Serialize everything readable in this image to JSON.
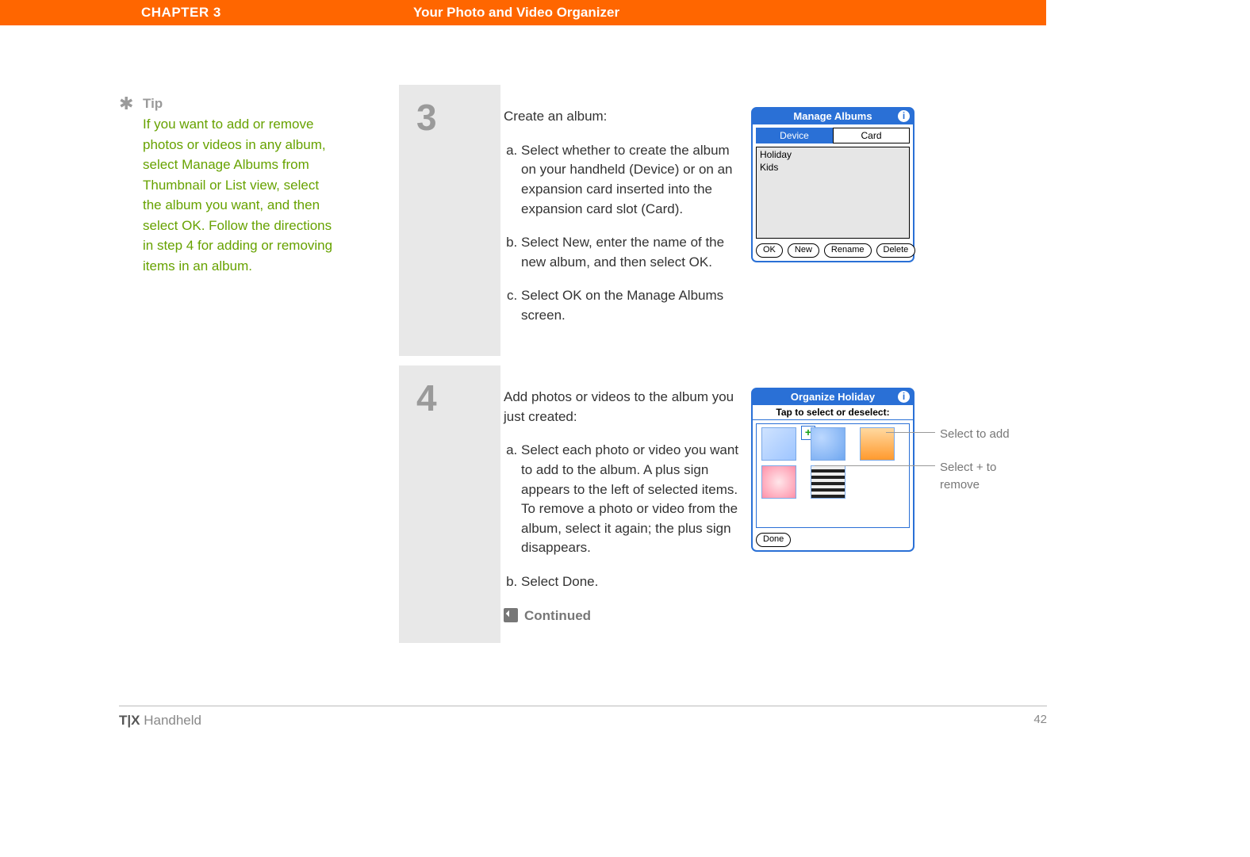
{
  "header": {
    "chapter": "CHAPTER 3",
    "title": "Your Photo and Video Organizer"
  },
  "tip": {
    "star": "✱",
    "label": "Tip",
    "body": "If you want to add or remove photos or videos in any album, select Manage Albums from Thumbnail or List view, select the album you want, and then select OK. Follow the directions in step 4 for adding or removing items in an album."
  },
  "step3": {
    "num": "3",
    "lead": "Create an album:",
    "a": "Select whether to create the album on your handheld (Device) or on an expansion card inserted into the expansion card slot (Card).",
    "b": "Select New, enter the name of the new album, and then select OK.",
    "c": "Select OK on the Manage Albums screen.",
    "palm": {
      "title": "Manage Albums",
      "tab_device": "Device",
      "tab_card": "Card",
      "album1": "Holiday",
      "album2": "Kids",
      "btn_ok": "OK",
      "btn_new": "New",
      "btn_rename": "Rename",
      "btn_delete": "Delete"
    }
  },
  "step4": {
    "num": "4",
    "lead": "Add photos or videos to the album you just created:",
    "a": "Select each photo or video you want to add to the album. A plus sign appears to the left of selected items. To remove a photo or video from the album, select it again; the plus sign disappears.",
    "b": "Select Done.",
    "continued": "Continued",
    "palm": {
      "title": "Organize Holiday",
      "subtitle": "Tap to select or deselect:",
      "plus": "+",
      "btn_done": "Done"
    },
    "callout_add": "Select to add",
    "callout_remove": "Select + to remove"
  },
  "footer": {
    "product_bold": "T|X",
    "product_rest": " Handheld",
    "page": "42"
  }
}
